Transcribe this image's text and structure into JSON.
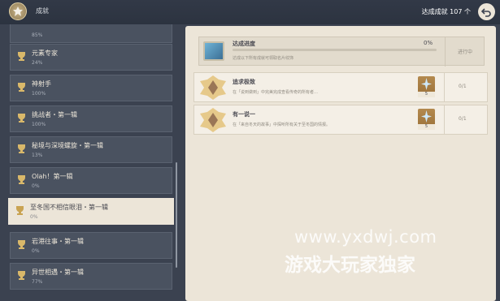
{
  "header": {
    "title": "成就",
    "total_label": "达成成就 107 个",
    "back_icon": "return-arrow-icon",
    "emblem_icon": "achievement-emblem-icon"
  },
  "list": {
    "items": [
      {
        "name": "",
        "pct": "85%"
      },
      {
        "name": "元素专家",
        "pct": "24%"
      },
      {
        "name": "神射手",
        "pct": "100%"
      },
      {
        "name": "挑战者・第一辑",
        "pct": "100%"
      },
      {
        "name": "秘境与深境螺旋・第一辑",
        "pct": "13%"
      },
      {
        "name": "Olah！第一辑",
        "pct": "0%"
      },
      {
        "name": "至冬国不相信眼泪・第一辑",
        "pct": "0%",
        "selected": true
      },
      {
        "name": "岩港往事・第一辑",
        "pct": "0%"
      },
      {
        "name": "异世相遇・第一辑",
        "pct": "77%"
      }
    ]
  },
  "progress": {
    "title": "达成进度",
    "desc": "达成以下所有成就可领取名片纹饰",
    "pct": "0%",
    "fraction": 0,
    "status": "进行中"
  },
  "achievements": [
    {
      "title": "追求极致",
      "desc": "在「说到做到」中完美完成查看传奇的所有者…",
      "reward_count": "5",
      "status": "0/1"
    },
    {
      "title": "有一说一",
      "desc": "在「来自冬天的故事」中探听所有关于至冬国的情报。",
      "reward_count": "5",
      "status": "0/1"
    }
  ],
  "watermark": {
    "line1": "www.yxdwj.com",
    "line2": "游戏大玩家独家"
  },
  "colors": {
    "panel": "#ece5d8",
    "background": "#3b4250",
    "progress_fill": "#7aa36a"
  }
}
